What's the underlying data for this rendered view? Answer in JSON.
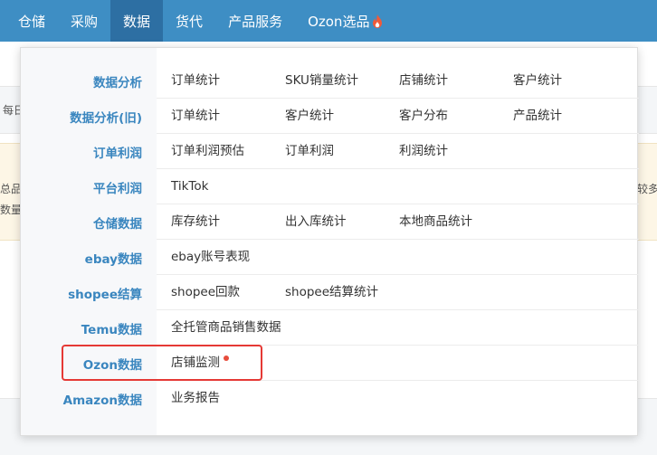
{
  "nav": {
    "items": [
      "仓储",
      "采购",
      "数据",
      "货代",
      "产品服务",
      "Ozon选品"
    ],
    "active_index": 2,
    "fire_icon": "fire-icon"
  },
  "background": {
    "left_text_1": "每日",
    "left_text_2": "总品",
    "left_text_3": "数量",
    "right_text": "较多"
  },
  "menu": {
    "rows": [
      {
        "category": "数据分析",
        "links": [
          "订单统计",
          "SKU销量统计",
          "店铺统计",
          "客户统计"
        ]
      },
      {
        "category": "数据分析(旧)",
        "links": [
          "订单统计",
          "客户统计",
          "客户分布",
          "产品统计"
        ]
      },
      {
        "category": "订单利润",
        "links": [
          "订单利润预估",
          "订单利润",
          "利润统计"
        ]
      },
      {
        "category": "平台利润",
        "links": [
          "TikTok"
        ]
      },
      {
        "category": "仓储数据",
        "links": [
          "库存统计",
          "出入库统计",
          "本地商品统计"
        ]
      },
      {
        "category": "ebay数据",
        "links": [
          "ebay账号表现"
        ]
      },
      {
        "category": "shopee结算",
        "links": [
          "shopee回款",
          "shopee结算统计"
        ]
      },
      {
        "category": "Temu数据",
        "links": [
          "全托管商品销售数据"
        ]
      },
      {
        "category": "Ozon数据",
        "links": [
          "店铺监测"
        ],
        "badge": true
      },
      {
        "category": "Amazon数据",
        "links": [
          "业务报告"
        ]
      }
    ]
  },
  "colors": {
    "nav_bg": "#3e8ec4",
    "nav_active_bg": "#2d6fa3",
    "category_text": "#3a86bf",
    "highlight_border": "#e53935",
    "badge": "#e74c3c"
  }
}
